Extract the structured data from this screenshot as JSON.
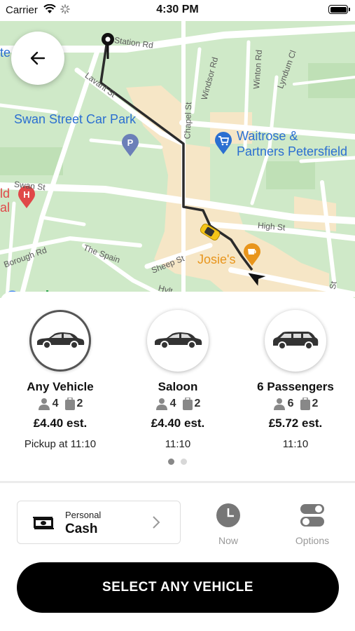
{
  "status_bar": {
    "carrier": "Carrier",
    "time": "4:30 PM"
  },
  "map": {
    "labels": {
      "swan_street_car_park": "Swan Street Car Park",
      "waitrose_line1": "Waitrose &",
      "waitrose_line2": "Partners Petersfield",
      "josies": "Josie's",
      "station_rd": "Station Rd",
      "lavant_st": "Lavant St",
      "chapel_st": "Chapel St",
      "windsor_rd": "Windsor Rd",
      "winton_rd": "Winton Rd",
      "lyndum_cl": "Lyndum Cl",
      "swan_st": "Swan St",
      "high_st": "High St",
      "borough_rd": "Borough Rd",
      "the_spain": "The Spain",
      "sheep_st": "Sheep St",
      "hylton": "Hylt",
      "edge_left_top": "te",
      "edge_left_mid1": "ld",
      "edge_left_mid2": "al",
      "edge_right": "St",
      "google": "Google"
    },
    "colors": {
      "route": "#2b2b2b",
      "poi_blue": "#2b6fd1",
      "poi_orange": "#e8951c",
      "hospital_red": "#e04848"
    }
  },
  "vehicles": [
    {
      "name": "Any Vehicle",
      "passengers": "4",
      "luggage": "2",
      "price": "£4.40 est.",
      "pickup": "Pickup at 11:10",
      "selected": true,
      "icon": "sedan-car-icon"
    },
    {
      "name": "Saloon",
      "passengers": "4",
      "luggage": "2",
      "price": "£4.40 est.",
      "pickup": "11:10",
      "selected": false,
      "icon": "sedan-car-icon"
    },
    {
      "name": "6 Passengers",
      "passengers": "6",
      "luggage": "2",
      "price": "£5.72 est.",
      "pickup": "11:10",
      "selected": false,
      "icon": "mpv-car-icon"
    }
  ],
  "pagination": {
    "pages": 2,
    "active": 1
  },
  "payment": {
    "sub_label": "Personal",
    "method": "Cash"
  },
  "actions": {
    "now_label": "Now",
    "options_label": "Options"
  },
  "cta": {
    "label": "SELECT ANY VEHICLE"
  }
}
